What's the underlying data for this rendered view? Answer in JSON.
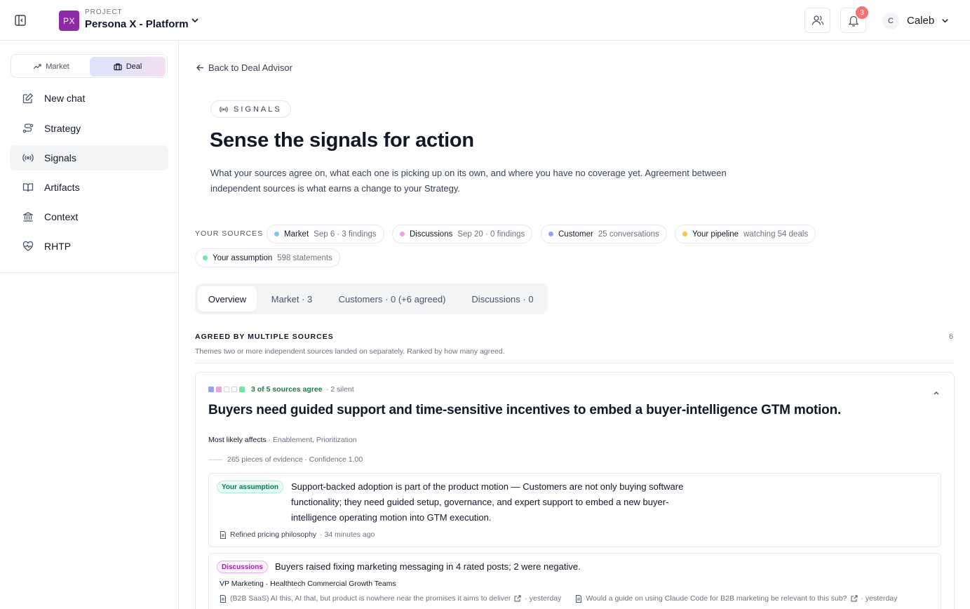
{
  "topbar": {
    "project_initials": "PX",
    "project_label": "PROJECT",
    "project_name": "Persona X - Platform",
    "notifications_count": "3",
    "user_initial": "C",
    "user_name": "Caleb"
  },
  "sidebar": {
    "modes": [
      {
        "label": "Market",
        "icon": "trend-up-icon",
        "active": false
      },
      {
        "label": "Deal",
        "icon": "briefcase-icon",
        "active": true
      }
    ],
    "items": [
      {
        "label": "New chat",
        "icon": "edit-icon",
        "active": false
      },
      {
        "label": "Strategy",
        "icon": "route-icon",
        "active": false
      },
      {
        "label": "Signals",
        "icon": "signal-icon",
        "active": true
      },
      {
        "label": "Artifacts",
        "icon": "book-icon",
        "active": false
      },
      {
        "label": "Context",
        "icon": "bank-icon",
        "active": false
      },
      {
        "label": "RHTP",
        "icon": "heart-pulse-icon",
        "active": false
      }
    ]
  },
  "main": {
    "back_link": "Back to Deal Advisor",
    "chip": "SIGNALS",
    "title": "Sense the signals for action",
    "description": "What your sources agree on, what each one is picking up on its own, and where you have no coverage yet. Agreement between independent sources is what earns a change to your Strategy.",
    "sources_label": "YOUR SOURCES",
    "sources": [
      {
        "name": "Market",
        "meta": "Sep 6 · 3 findings",
        "color": "#7ec8f0"
      },
      {
        "name": "Discussions",
        "meta": "Sep 20 · 0 findings",
        "color": "#e9a3e0"
      },
      {
        "name": "Customer",
        "meta": "25 conversations",
        "color": "#8fa4f0"
      },
      {
        "name": "Your pipeline",
        "meta": "watching 54 deals",
        "color": "#f5c542"
      },
      {
        "name": "Your assumption",
        "meta": "598 statements",
        "color": "#6ee7a8"
      }
    ],
    "tabs": [
      {
        "label": "Overview",
        "active": true
      },
      {
        "label": "Market · 3",
        "active": false
      },
      {
        "label": "Customers · 0 (+6 agreed)",
        "active": false
      },
      {
        "label": "Discussions · 0",
        "active": false
      }
    ],
    "agreed": {
      "title": "AGREED BY MULTIPLE SOURCES",
      "count": "6",
      "subtitle": "Themes two or more independent sources landed on separately. Ranked by how many agreed."
    },
    "card": {
      "agreement": "3 of 5 sources agree",
      "silent": "· 2 silent",
      "source_squares": [
        "#8fa4f0",
        "#e9a3e0",
        "none",
        "none",
        "#6ee7a8"
      ],
      "title": "Buyers need guided support and time-sensitive incentives to embed a buyer-intelligence GTM motion.",
      "affects_label": "Most likely affects",
      "affects_value": " · Enablement, Prioritization",
      "evidence": "265 pieces of evidence · Confidence 1.00",
      "assumption": {
        "tag": "Your assumption",
        "text": "Support-backed adoption is part of the product motion — Customers are not only buying software functionality; they need guided setup, governance, and expert support to embed a new buyer-intelligence operating motion into GTM execution.",
        "source": "Refined pricing philosophy",
        "time": "· 34 minutes ago"
      },
      "discussion": {
        "tag": "Discussions",
        "text": "Buyers raised fixing marketing messaging in 4 rated posts; 2 were negative.",
        "role": "VP Marketing · Healthtech Commercial Growth Teams",
        "posts": [
          {
            "title": "(B2B SaaS) AI this, AI that, but product is nowhere near the promises it aims to deliver",
            "time": "· yesterday"
          },
          {
            "title": "Would a guide on using Claude Code for B2B marketing be relevant to this sub?",
            "time": "· yesterday"
          }
        ]
      }
    }
  }
}
